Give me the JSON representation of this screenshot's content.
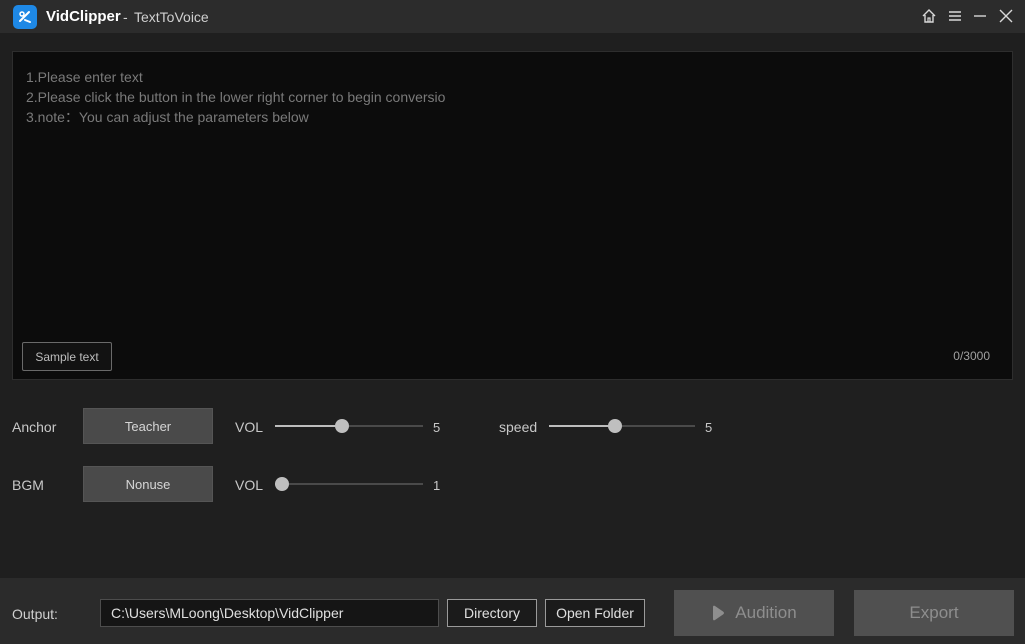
{
  "titlebar": {
    "app_name": "VidClipper",
    "separator": "-",
    "subtitle": "TextToVoice",
    "icons": [
      "home-icon",
      "menu-icon",
      "minimize-icon",
      "close-icon"
    ]
  },
  "editor": {
    "placeholder_lines": [
      "1.Please enter text",
      "2.Please click the button in the lower right corner to begin conversio",
      "3.note：You can adjust the parameters below"
    ],
    "sample_button": "Sample text",
    "counter": "0/3000"
  },
  "anchor": {
    "label": "Anchor",
    "voice": "Teacher",
    "vol_label": "VOL",
    "vol_value": "5",
    "vol_fraction": 0.45,
    "speed_label": "speed",
    "speed_value": "5",
    "speed_fraction": 0.45
  },
  "bgm": {
    "label": "BGM",
    "track": "Nonuse",
    "vol_label": "VOL",
    "vol_value": "1",
    "vol_fraction": 0.0
  },
  "footer": {
    "output_label": "Output:",
    "output_path": "C:\\Users\\MLoong\\Desktop\\VidClipper",
    "directory_button": "Directory",
    "open_folder_button": "Open Folder",
    "audition_button": "Audition",
    "export_button": "Export"
  },
  "colors": {
    "background": "#1f1f1f",
    "titlebar": "#2c2c2c",
    "editor_bg": "#0c0c0c",
    "logo_blue": "#1e88e5",
    "disabled_button": "#505050"
  }
}
